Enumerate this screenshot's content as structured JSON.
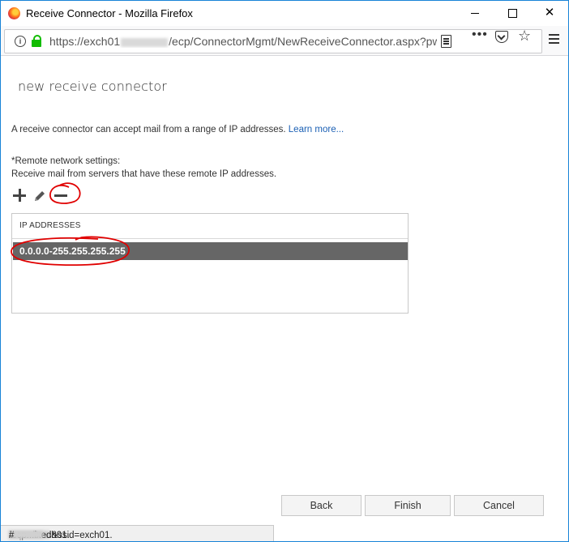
{
  "window": {
    "title": "Receive Connector - Mozilla Firefox",
    "controls": {
      "minimize": "minimize",
      "maximize": "maximize",
      "close": "✕"
    }
  },
  "urlbar": {
    "url_prefix": "https://exch01",
    "url_suffix": "/ecp/ConnectorMgmt/NewReceiveConnector.aspx?pw",
    "icons": [
      "info-icon",
      "lock-icon",
      "reader-icon",
      "more-icon",
      "pocket-icon",
      "star-icon",
      "menu-icon"
    ],
    "lock_color": "#12bc00"
  },
  "page": {
    "title": "new receive connector",
    "description": "A receive connector can accept mail from a range of IP addresses.",
    "learn_more": "Learn more...",
    "settings_label": "*Remote network settings:",
    "settings_sub": "Receive mail from servers that have these remote IP addresses."
  },
  "toolbar": {
    "icons": [
      "add-icon",
      "edit-icon",
      "remove-icon"
    ]
  },
  "ip_table": {
    "header": "IP ADDRESSES",
    "rows": [
      "0.0.0.0-255.255.255.255"
    ],
    "selected_row_color": "#666666"
  },
  "annotations": {
    "color": "#e00000",
    "circled": [
      "remove-icon",
      "ip-row"
    ]
  },
  "buttons": {
    "back": "Back",
    "finish": "Finish",
    "cancel": "Cancel"
  },
  "statusbar": {
    "prefix": "https://exch01.",
    "middle": "/ecp...ixed&ssid=exch01.",
    "suffix": "#"
  }
}
